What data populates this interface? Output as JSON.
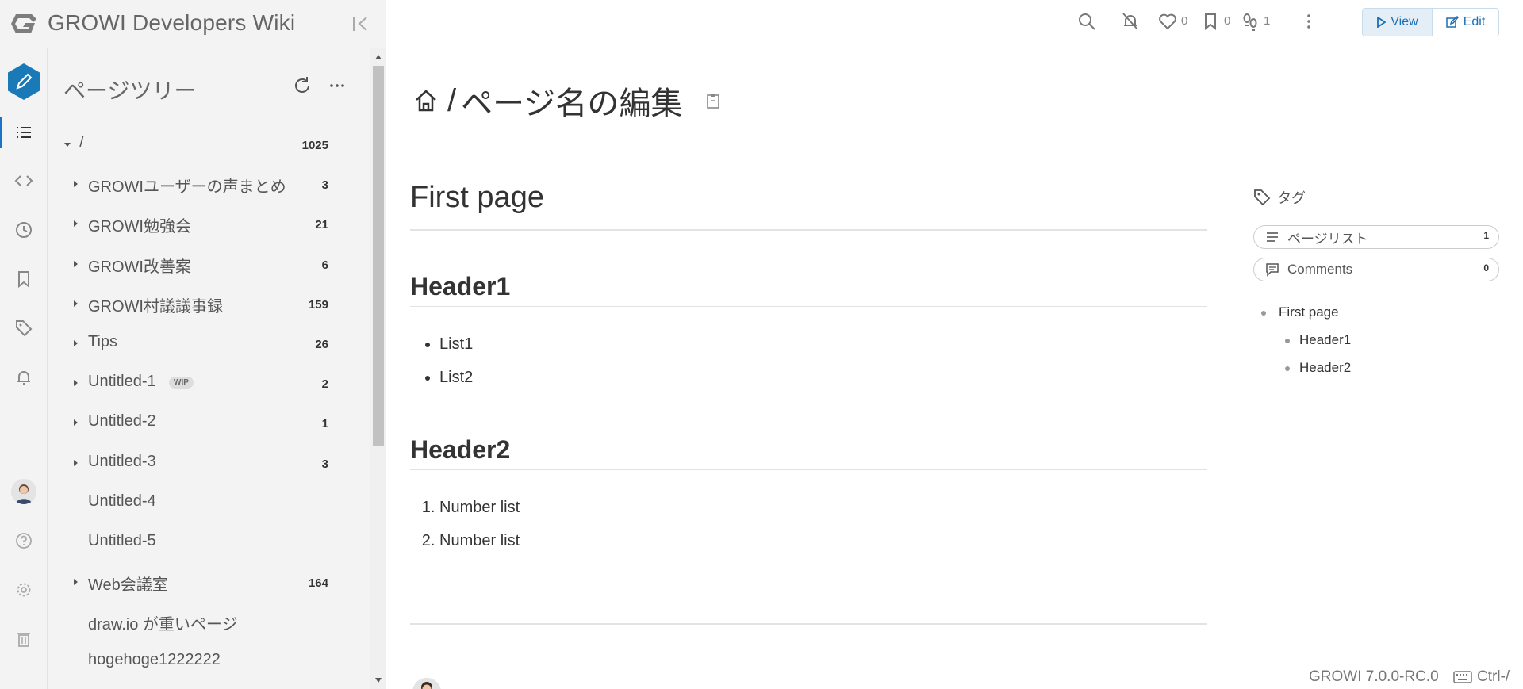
{
  "brand": {
    "title": "GROWI Developers Wiki"
  },
  "tree": {
    "title": "ページツリー",
    "items": [
      {
        "label": "/",
        "count": "1025",
        "caret": "down"
      },
      {
        "label": "GROWIユーザーの声まとめ",
        "count": "3",
        "caret": "right"
      },
      {
        "label": "GROWI勉強会",
        "count": "21",
        "caret": "right"
      },
      {
        "label": "GROWI改善案",
        "count": "6",
        "caret": "right"
      },
      {
        "label": "GROWI村議議事録",
        "count": "159",
        "caret": "right"
      },
      {
        "label": "Tips",
        "count": "26",
        "caret": "right"
      },
      {
        "label": "Untitled-1",
        "count": "2",
        "caret": "right",
        "badge": "WIP"
      },
      {
        "label": "Untitled-2",
        "count": "1",
        "caret": "right"
      },
      {
        "label": "Untitled-3",
        "count": "3",
        "caret": "right"
      },
      {
        "label": "Untitled-4",
        "count": "",
        "caret": "none"
      },
      {
        "label": "Untitled-5",
        "count": "",
        "caret": "none"
      },
      {
        "label": "Web会議室",
        "count": "164",
        "caret": "right"
      },
      {
        "label": "draw.io が重いページ",
        "count": "",
        "caret": "none"
      },
      {
        "label": "hogehoge1222222",
        "count": "",
        "caret": "none"
      }
    ]
  },
  "toolbar": {
    "like_count": "0",
    "bookmark_count": "0",
    "seen_count": "1",
    "view_label": "View",
    "edit_label": "Edit"
  },
  "page": {
    "path_separator": "/",
    "path_name": "ページ名の編集",
    "h1": "First page",
    "header1": "Header1",
    "list1": [
      "List1",
      "List2"
    ],
    "header2": "Header2",
    "list2": [
      "Number list",
      "Number list"
    ]
  },
  "side": {
    "tags_label": "タグ",
    "page_list_label": "ページリスト",
    "page_list_count": "1",
    "comments_label": "Comments",
    "comments_count": "0",
    "toc": [
      "First page",
      "Header1",
      "Header2"
    ]
  },
  "footer": {
    "version": "GROWI 7.0.0-RC.0",
    "shortcut": "Ctrl-/"
  },
  "colors": {
    "accent": "#1a73c8",
    "edit_button": "#1a7ab8",
    "sidebar_bg": "#f3f3f3"
  }
}
